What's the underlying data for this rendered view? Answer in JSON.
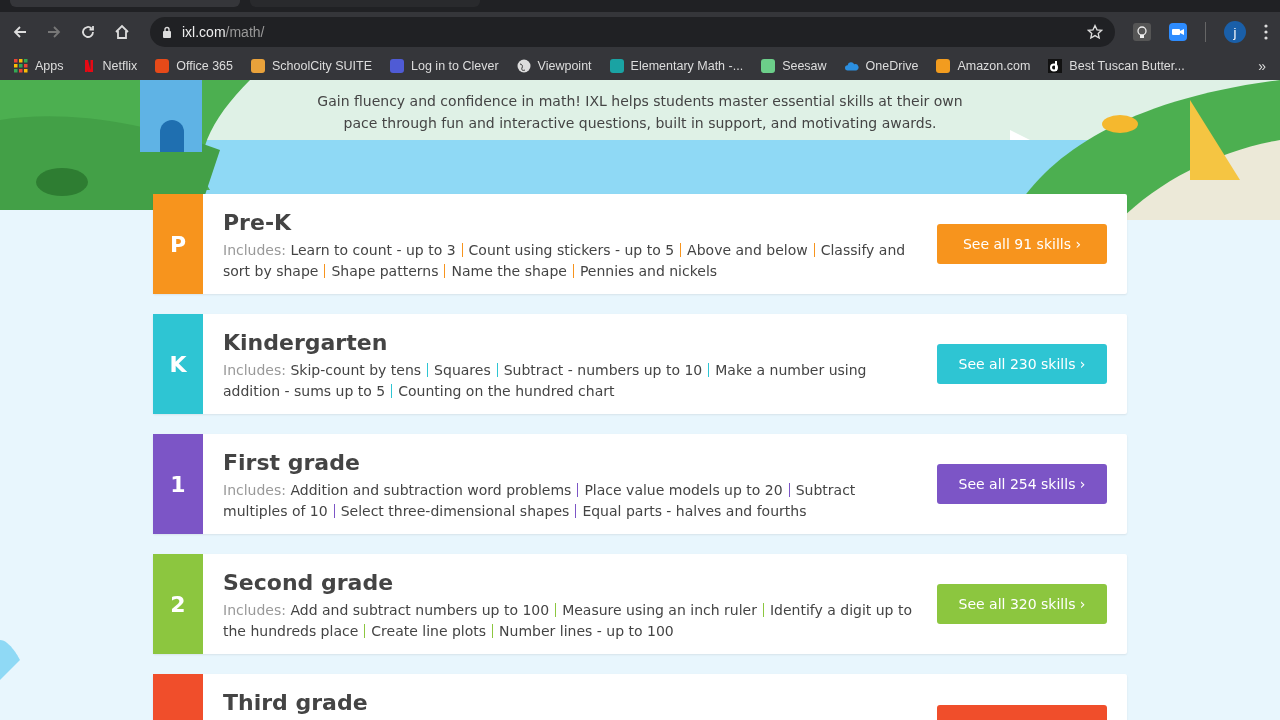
{
  "browser": {
    "address": {
      "host": "ixl.com",
      "path": "/math/"
    },
    "profile_initial": "j",
    "bookmarks": [
      {
        "label": "Apps",
        "kind": "apps"
      },
      {
        "label": "Netflix",
        "kind": "netflix"
      },
      {
        "label": "Office 365",
        "kind": "office"
      },
      {
        "label": "SchoolCity SUITE",
        "kind": "schoolcity"
      },
      {
        "label": "Log in to Clever",
        "kind": "clever"
      },
      {
        "label": "Viewpoint",
        "kind": "globe"
      },
      {
        "label": "Elementary Math -...",
        "kind": "math"
      },
      {
        "label": "Seesaw",
        "kind": "seesaw"
      },
      {
        "label": "OneDrive",
        "kind": "cloud"
      },
      {
        "label": "Amazon.com",
        "kind": "amazon"
      },
      {
        "label": "Best Tuscan Butter...",
        "kind": "d"
      }
    ],
    "overflow": "»"
  },
  "intro": "Gain fluency and confidence in math! IXL helps students master essential skills at their own pace through fun and interactive questions, built in support, and motivating awards.",
  "grades": [
    {
      "badge": "P",
      "title": "Pre-K",
      "color": "#f7941d",
      "includes": "Includes:",
      "skills": [
        "Learn to count - up to 3",
        "Count using stickers - up to 5",
        "Above and below",
        "Classify and sort by shape",
        "Shape patterns",
        "Name the shape",
        "Pennies and nickels"
      ],
      "button": "See all 91 skills ›"
    },
    {
      "badge": "K",
      "title": "Kindergarten",
      "color": "#2ec5d3",
      "includes": "Includes:",
      "skills": [
        "Skip-count by tens",
        "Squares",
        "Subtract - numbers up to 10",
        "Make a number using addition - sums up to 5",
        "Counting on the hundred chart"
      ],
      "button": "See all 230 skills ›"
    },
    {
      "badge": "1",
      "title": "First grade",
      "color": "#7c55c6",
      "includes": "Includes:",
      "skills": [
        "Addition and subtraction word problems",
        "Place value models up to 20",
        "Subtract multiples of 10",
        "Select three-dimensional shapes",
        "Equal parts - halves and fourths"
      ],
      "button": "See all 254 skills ›"
    },
    {
      "badge": "2",
      "title": "Second grade",
      "color": "#8cc63f",
      "includes": "Includes:",
      "skills": [
        "Add and subtract numbers up to 100",
        "Measure using an inch ruler",
        "Identify a digit up to the hundreds place",
        "Create line plots",
        "Number lines - up to 100"
      ],
      "button": "See all 320 skills ›"
    },
    {
      "title": "Third grade",
      "color": "#f04e2b"
    }
  ]
}
